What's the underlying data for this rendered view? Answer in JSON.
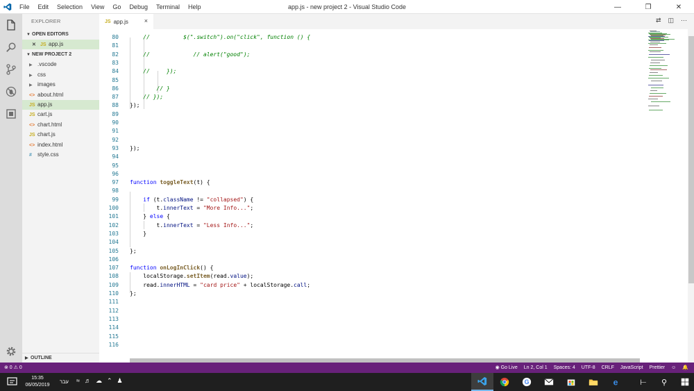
{
  "window": {
    "title": "app.js - new project 2 - Visual Studio Code",
    "menu": [
      "File",
      "Edit",
      "Selection",
      "View",
      "Go",
      "Debug",
      "Terminal",
      "Help"
    ]
  },
  "sidebar": {
    "title": "EXPLORER",
    "open_editors_label": "OPEN EDITORS",
    "open_editors": [
      {
        "name": "app.js",
        "type": "js"
      }
    ],
    "project_label": "NEW PROJECT 2",
    "items": [
      {
        "name": ".vscode",
        "type": "folder"
      },
      {
        "name": "css",
        "type": "folder"
      },
      {
        "name": "images",
        "type": "folder"
      },
      {
        "name": "about.html",
        "type": "html"
      },
      {
        "name": "app.js",
        "type": "js"
      },
      {
        "name": "cart.js",
        "type": "js"
      },
      {
        "name": "chart.html",
        "type": "html"
      },
      {
        "name": "chart.js",
        "type": "js"
      },
      {
        "name": "index.html",
        "type": "html"
      },
      {
        "name": "style.css",
        "type": "css"
      }
    ],
    "outline_label": "OUTLINE"
  },
  "tab": {
    "label": "app.js",
    "close": "×"
  },
  "editor": {
    "lines": [
      {
        "n": "80",
        "html": "    <span class=\"c-comment\">//          $(\".switch\").on(\"click\", function () {</span>"
      },
      {
        "n": "81",
        "html": ""
      },
      {
        "n": "82",
        "html": "    <span class=\"c-comment\">//             // alert(\"good\");</span>"
      },
      {
        "n": "83",
        "html": ""
      },
      {
        "n": "84",
        "html": "    <span class=\"c-comment\">//     });</span>"
      },
      {
        "n": "85",
        "html": ""
      },
      {
        "n": "86",
        "html": "        <span class=\"c-comment\">// }</span>"
      },
      {
        "n": "87",
        "html": "    <span class=\"c-comment\">// });</span>"
      },
      {
        "n": "88",
        "html": "});"
      },
      {
        "n": "89",
        "html": ""
      },
      {
        "n": "90",
        "html": ""
      },
      {
        "n": "91",
        "html": ""
      },
      {
        "n": "92",
        "html": ""
      },
      {
        "n": "93",
        "html": "});"
      },
      {
        "n": "94",
        "html": ""
      },
      {
        "n": "95",
        "html": ""
      },
      {
        "n": "96",
        "html": ""
      },
      {
        "n": "97",
        "html": "<span class=\"c-kw\">function</span> <span class=\"c-fn\">toggleText</span>(t) {"
      },
      {
        "n": "98",
        "html": ""
      },
      {
        "n": "99",
        "html": "    <span class=\"c-kw\">if</span> (t.<span class=\"c-prop\">className</span> != <span class=\"c-str\">\"collapsed\"</span>) {"
      },
      {
        "n": "100",
        "html": "        t.<span class=\"c-prop\">innerText</span> = <span class=\"c-str\">\"More Info...\"</span>;"
      },
      {
        "n": "101",
        "html": "    } <span class=\"c-kw\">else</span> {"
      },
      {
        "n": "102",
        "html": "        t.<span class=\"c-prop\">innerText</span> = <span class=\"c-str\">\"Less Info...\"</span>;"
      },
      {
        "n": "103",
        "html": "    }"
      },
      {
        "n": "104",
        "html": ""
      },
      {
        "n": "105",
        "html": "};"
      },
      {
        "n": "106",
        "html": ""
      },
      {
        "n": "107",
        "html": "<span class=\"c-kw\">function</span> <span class=\"c-fn\">onLogInClick</span>() {"
      },
      {
        "n": "108",
        "html": "    localStorage.<span class=\"c-fn\">setItem</span>(read.<span class=\"c-prop\">value</span>);"
      },
      {
        "n": "109",
        "html": "    read.<span class=\"c-prop\">innerHTML</span> = <span class=\"c-str\">\"card price\"</span> + localStorage.<span class=\"c-prop\">call</span>;"
      },
      {
        "n": "110",
        "html": "};"
      },
      {
        "n": "111",
        "html": ""
      },
      {
        "n": "112",
        "html": ""
      },
      {
        "n": "113",
        "html": ""
      },
      {
        "n": "114",
        "html": ""
      },
      {
        "n": "115",
        "html": ""
      },
      {
        "n": "116",
        "html": ""
      }
    ]
  },
  "status": {
    "problems": "⊗ 0 ⚠ 0",
    "go_live": "Go Live",
    "position": "Ln 2, Col 1",
    "spaces": "Spaces: 4",
    "encoding": "UTF-8",
    "eol": "CRLF",
    "language": "JavaScript",
    "formatter": "Prettier"
  },
  "taskbar": {
    "time": "15:35",
    "date": "06/05/2019",
    "language": "עבר"
  },
  "colors": {
    "statusbar": "#68217a",
    "accent": "#007acc"
  }
}
